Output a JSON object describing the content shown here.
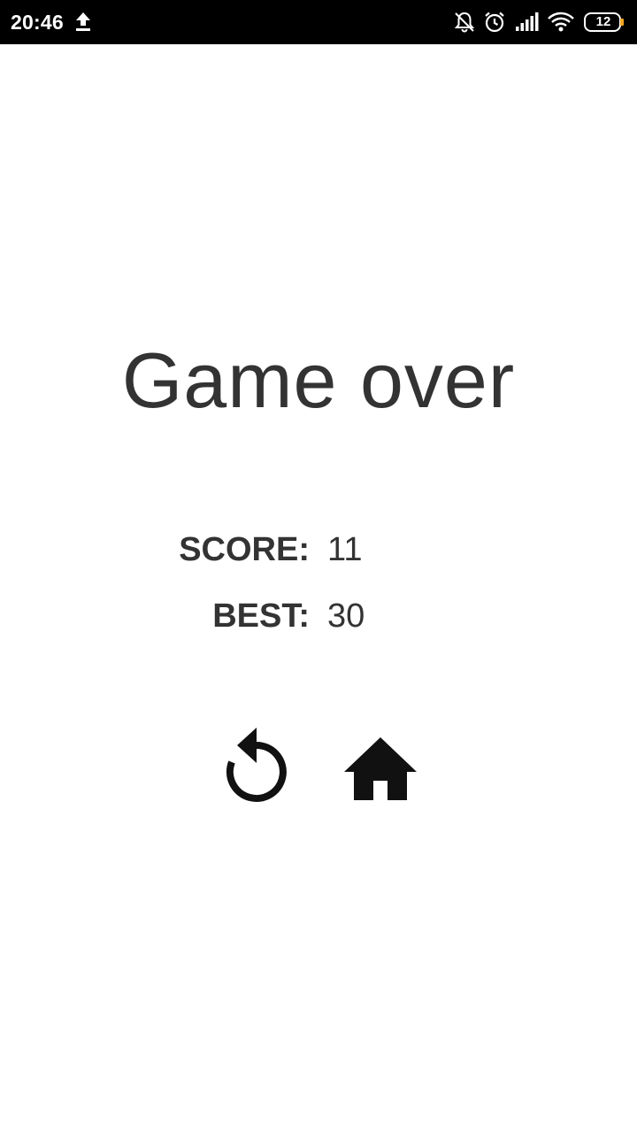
{
  "status_bar": {
    "time": "20:46",
    "battery_level": "12",
    "icons": [
      "upload-icon",
      "muted-bell-icon",
      "alarm-icon",
      "signal-icon",
      "wifi-icon",
      "battery-icon"
    ]
  },
  "game_over": {
    "title": "Game over",
    "score_label": "SCORE:",
    "score_value": "11",
    "best_label": "BEST:",
    "best_value": "30"
  },
  "buttons": {
    "replay_icon": "replay-icon",
    "home_icon": "home-icon"
  },
  "colors": {
    "text": "#333333",
    "icon": "#111111",
    "battery_accent": "#f5a623"
  }
}
